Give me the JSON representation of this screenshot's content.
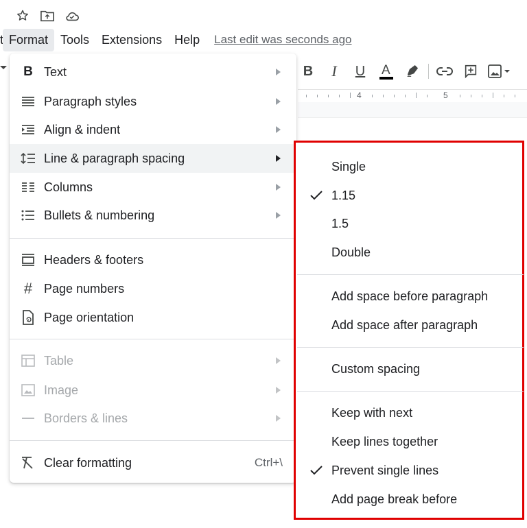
{
  "top_icons": [
    "star-icon",
    "move-to-folder-icon",
    "cloud-status-icon"
  ],
  "menubar": {
    "items": [
      {
        "label": "Format",
        "active": true
      },
      {
        "label": "Tools"
      },
      {
        "label": "Extensions"
      },
      {
        "label": "Help"
      }
    ],
    "last_edit": "Last edit was seconds ago"
  },
  "toolbar": [
    "bold-icon",
    "italic-icon",
    "underline-icon",
    "text-color-icon",
    "highlight-icon",
    "link-icon",
    "comment-icon",
    "image-icon"
  ],
  "ruler": {
    "labels": [
      "4",
      "5"
    ]
  },
  "format_menu": {
    "items": [
      {
        "label": "Text",
        "icon": "bold-icon"
      },
      {
        "label": "Paragraph styles",
        "icon": "paragraph-styles-icon"
      },
      {
        "label": "Align & indent",
        "icon": "align-indent-icon"
      },
      {
        "label": "Line & paragraph spacing",
        "icon": "line-spacing-icon"
      },
      {
        "label": "Columns",
        "icon": "columns-icon"
      },
      {
        "label": "Bullets & numbering",
        "icon": "bullets-icon"
      },
      {
        "label": "Headers & footers",
        "icon": "headers-footers-icon"
      },
      {
        "label": "Page numbers",
        "icon": "hash-icon"
      },
      {
        "label": "Page orientation",
        "icon": "page-orientation-icon"
      },
      {
        "label": "Table",
        "icon": "table-icon"
      },
      {
        "label": "Image",
        "icon": "image-icon"
      },
      {
        "label": "Borders & lines",
        "icon": "borders-lines-icon"
      },
      {
        "label": "Clear formatting",
        "icon": "clear-formatting-icon",
        "shortcut": "Ctrl+\\"
      }
    ]
  },
  "spacing_submenu": {
    "items": [
      {
        "label": "Single",
        "checked": false
      },
      {
        "label": "1.15",
        "checked": true
      },
      {
        "label": "1.5",
        "checked": false
      },
      {
        "label": "Double",
        "checked": false
      },
      {
        "label": "Add space before paragraph",
        "checked": false
      },
      {
        "label": "Add space after paragraph",
        "checked": false
      },
      {
        "label": "Custom spacing",
        "checked": false
      },
      {
        "label": "Keep with next",
        "checked": false
      },
      {
        "label": "Keep lines together",
        "checked": false
      },
      {
        "label": "Prevent single lines",
        "checked": true
      },
      {
        "label": "Add page break before",
        "checked": false
      }
    ]
  },
  "colors": {
    "highlight_border": "#e00000",
    "menu_hover": "#f1f3f4"
  }
}
